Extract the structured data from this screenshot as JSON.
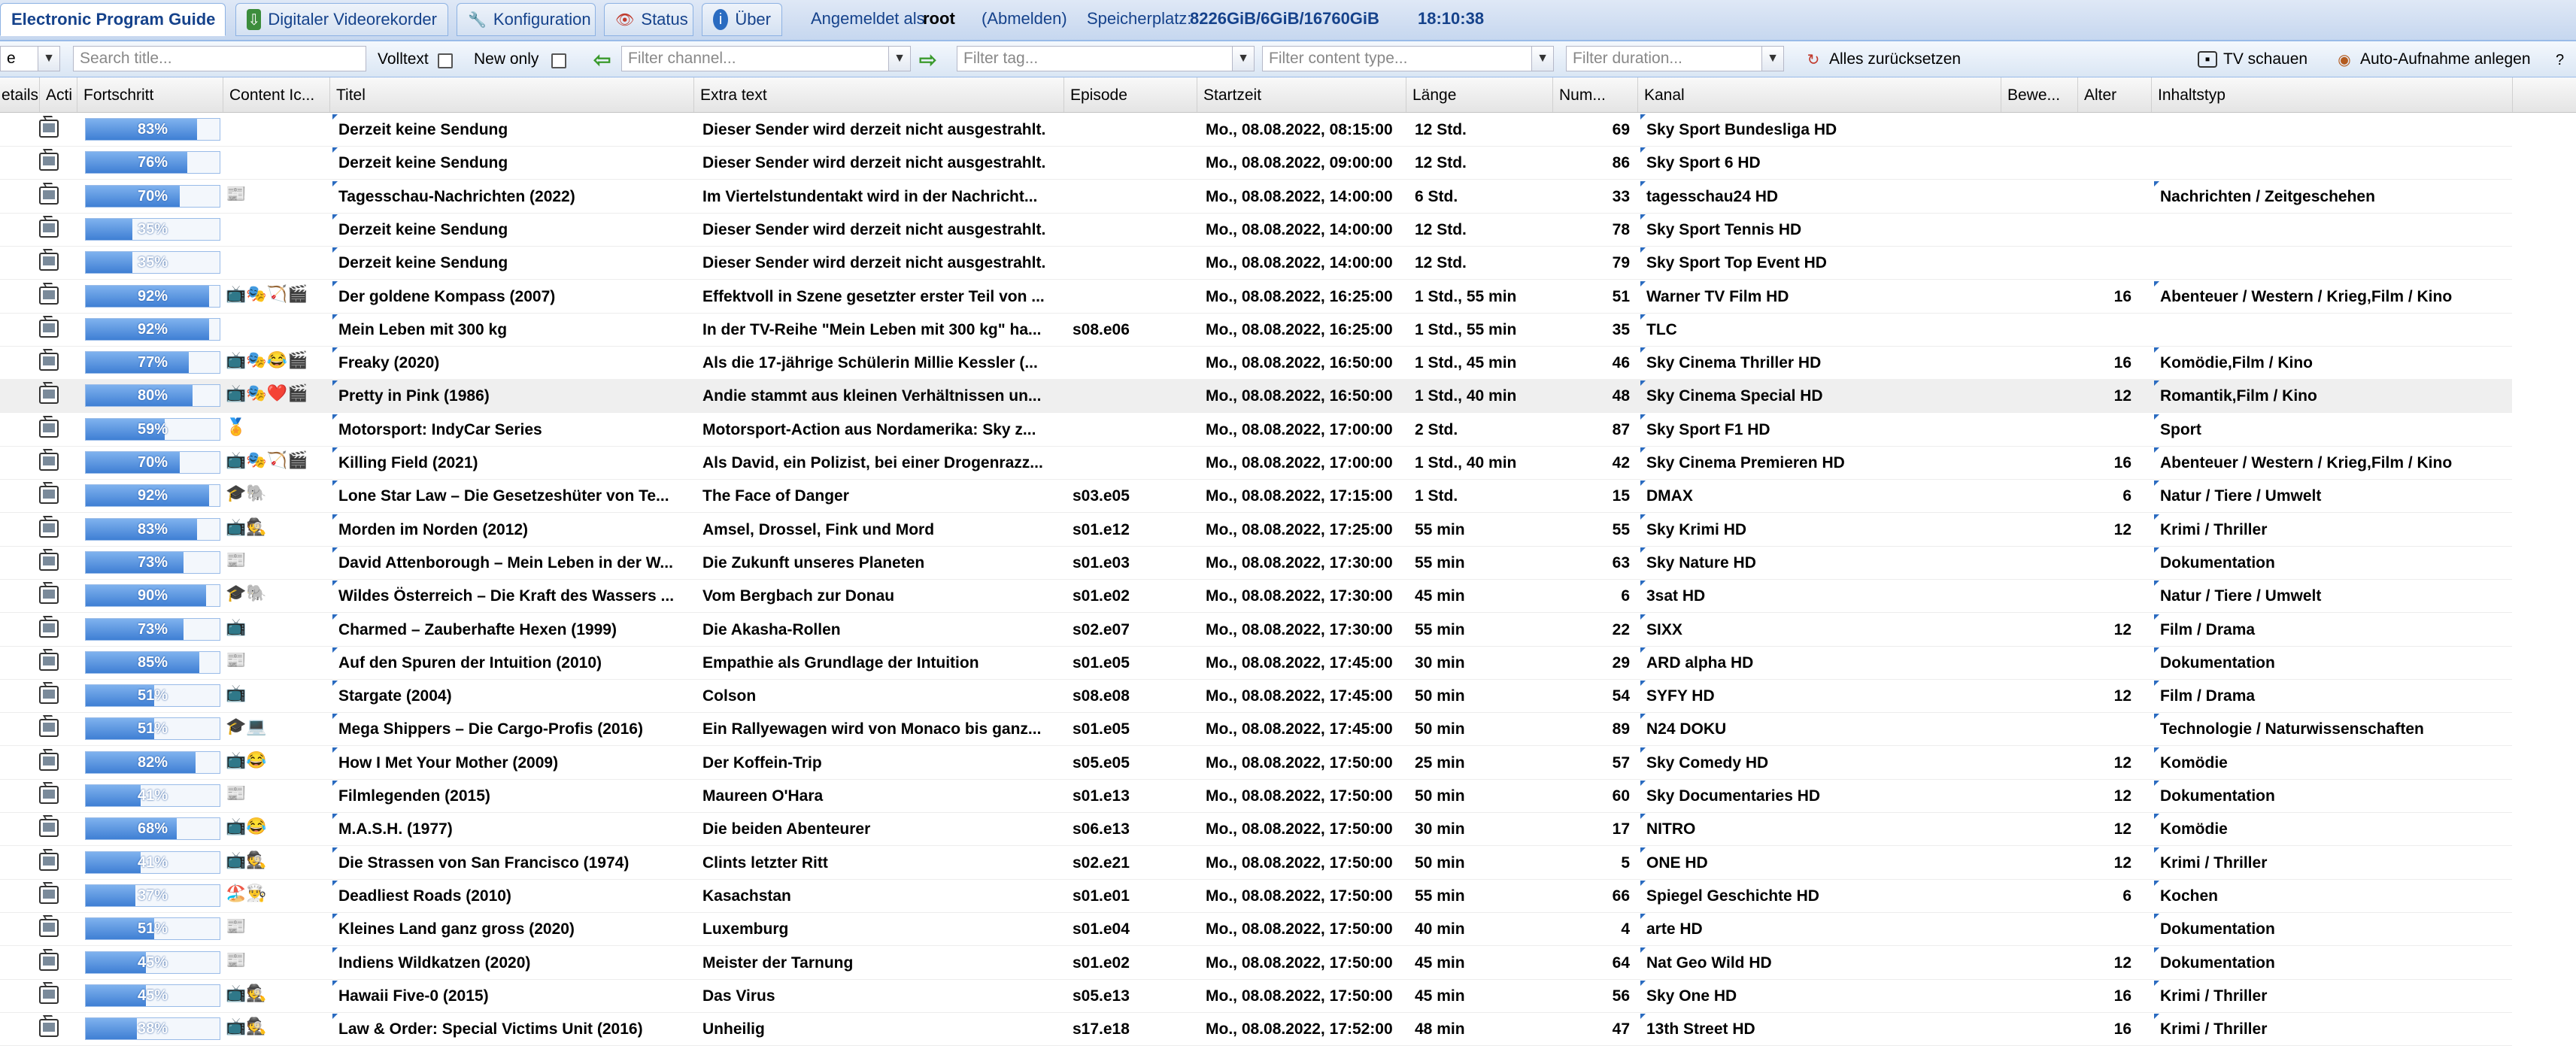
{
  "topbar": {
    "tabs": [
      {
        "label": "Electronic Program Guide",
        "icon": "",
        "active": true
      },
      {
        "label": "Digitaler Videorekorder",
        "icon": "dvr-icon",
        "active": false
      },
      {
        "label": "Konfiguration",
        "icon": "wrench-icon",
        "active": false
      },
      {
        "label": "Status",
        "icon": "eye-icon",
        "active": false
      },
      {
        "label": "Über",
        "icon": "info-icon",
        "active": false
      }
    ],
    "login_prefix": "Angemeldet als",
    "user": "root",
    "logout": "(Abmelden)",
    "storage_label": "Speicherplatz:",
    "storage_value": "8226GiB/6GiB/16760GiB",
    "clock": "18:10:38"
  },
  "toolbar": {
    "first_combo": "e",
    "title_placeholder": "Search title...",
    "volltext_label": "Volltext",
    "new_only_label": "New only",
    "channel_placeholder": "Filter channel...",
    "tag_placeholder": "Filter tag...",
    "content_placeholder": "Filter content type...",
    "duration_placeholder": "Filter duration...",
    "reset_label": "Alles zurücksetzen",
    "tv_label": "TV schauen",
    "auto_rec_label": "Auto-Aufnahme anlegen"
  },
  "columns": [
    "etails",
    "Acti",
    "Fortschritt",
    "Content Ic...",
    "Titel",
    "Extra text",
    "Episode",
    "Startzeit",
    "Länge",
    "Num...",
    "Kanal",
    "Bewe...",
    "Alter",
    "Inhaltstyp"
  ],
  "rows": [
    {
      "progress": 83,
      "p": "83%",
      "emo": "",
      "title": "Derzeit keine Sendung",
      "extra": "Dieser Sender wird derzeit nicht ausgestrahlt.",
      "ep": "",
      "start": "Mo., 08.08.2022, 08:15:00",
      "len": "12 Std.",
      "num": "69",
      "channel": "Sky Sport Bundesliga HD",
      "age": "",
      "type": ""
    },
    {
      "progress": 76,
      "p": "76%",
      "emo": "",
      "title": "Derzeit keine Sendung",
      "extra": "Dieser Sender wird derzeit nicht ausgestrahlt.",
      "ep": "",
      "start": "Mo., 08.08.2022, 09:00:00",
      "len": "12 Std.",
      "num": "86",
      "channel": "Sky Sport 6 HD",
      "age": "",
      "type": ""
    },
    {
      "progress": 70,
      "p": "70%",
      "emo": "📰",
      "title": "Tagesschau-Nachrichten (2022)",
      "extra": "Im Viertelstundentakt wird in der Nachricht...",
      "ep": "",
      "start": "Mo., 08.08.2022, 14:00:00",
      "len": "6 Std.",
      "num": "33",
      "channel": "tagesschau24 HD",
      "age": "",
      "type": "Nachrichten / Zeitgeschehen"
    },
    {
      "progress": 35,
      "p": "35%",
      "emo": "",
      "title": "Derzeit keine Sendung",
      "extra": "Dieser Sender wird derzeit nicht ausgestrahlt.",
      "ep": "",
      "start": "Mo., 08.08.2022, 14:00:00",
      "len": "12 Std.",
      "num": "78",
      "channel": "Sky Sport Tennis HD",
      "age": "",
      "type": ""
    },
    {
      "progress": 35,
      "p": "35%",
      "emo": "",
      "title": "Derzeit keine Sendung",
      "extra": "Dieser Sender wird derzeit nicht ausgestrahlt.",
      "ep": "",
      "start": "Mo., 08.08.2022, 14:00:00",
      "len": "12 Std.",
      "num": "79",
      "channel": "Sky Sport Top Event HD",
      "age": "",
      "type": ""
    },
    {
      "progress": 92,
      "p": "92%",
      "emo": "📺🎭🏹🎬",
      "title": "Der goldene Kompass (2007)",
      "extra": "Effektvoll in Szene gesetzter erster Teil von ...",
      "ep": "",
      "start": "Mo., 08.08.2022, 16:25:00",
      "len": "1 Std., 55 min",
      "num": "51",
      "channel": "Warner TV Film HD",
      "age": "16",
      "type": "Abenteuer / Western / Krieg,Film / Kino"
    },
    {
      "progress": 92,
      "p": "92%",
      "emo": "",
      "title": "Mein Leben mit 300 kg",
      "extra": "In der TV-Reihe \"Mein Leben mit 300 kg\" ha...",
      "ep": "s08.e06",
      "start": "Mo., 08.08.2022, 16:25:00",
      "len": "1 Std., 55 min",
      "num": "35",
      "channel": "TLC",
      "age": "",
      "type": ""
    },
    {
      "progress": 77,
      "p": "77%",
      "emo": "📺🎭😂🎬",
      "title": "Freaky (2020)",
      "extra": "Als die 17-jährige Schülerin Millie Kessler (...",
      "ep": "",
      "start": "Mo., 08.08.2022, 16:50:00",
      "len": "1 Std., 45 min",
      "num": "46",
      "channel": "Sky Cinema Thriller HD",
      "age": "16",
      "type": "Komödie,Film / Kino"
    },
    {
      "progress": 80,
      "p": "80%",
      "emo": "📺🎭❤️🎬",
      "title": "Pretty in Pink (1986)",
      "extra": "Andie stammt aus kleinen Verhältnissen un...",
      "ep": "",
      "start": "Mo., 08.08.2022, 16:50:00",
      "len": "1 Std., 40 min",
      "num": "48",
      "channel": "Sky Cinema Special HD",
      "age": "12",
      "type": "Romantik,Film / Kino",
      "selected": true
    },
    {
      "progress": 59,
      "p": "59%",
      "emo": "🏅",
      "title": "Motorsport: IndyCar Series",
      "extra": "Motorsport-Action aus Nordamerika: Sky z...",
      "ep": "",
      "start": "Mo., 08.08.2022, 17:00:00",
      "len": "2 Std.",
      "num": "87",
      "channel": "Sky Sport F1 HD",
      "age": "",
      "type": "Sport"
    },
    {
      "progress": 70,
      "p": "70%",
      "emo": "📺🎭🏹🎬",
      "title": "Killing Field (2021)",
      "extra": "Als David, ein Polizist, bei einer Drogenrazz...",
      "ep": "",
      "start": "Mo., 08.08.2022, 17:00:00",
      "len": "1 Std., 40 min",
      "num": "42",
      "channel": "Sky Cinema Premieren HD",
      "age": "16",
      "type": "Abenteuer / Western / Krieg,Film / Kino"
    },
    {
      "progress": 92,
      "p": "92%",
      "emo": "🎓🐘",
      "title": "Lone Star Law – Die Gesetzeshüter von Te...",
      "extra": "The Face of Danger",
      "ep": "s03.e05",
      "start": "Mo., 08.08.2022, 17:15:00",
      "len": "1 Std.",
      "num": "15",
      "channel": "DMAX",
      "age": "6",
      "type": "Natur / Tiere / Umwelt"
    },
    {
      "progress": 83,
      "p": "83%",
      "emo": "📺🕵️",
      "title": "Morden im Norden (2012)",
      "extra": "Amsel, Drossel, Fink und Mord",
      "ep": "s01.e12",
      "start": "Mo., 08.08.2022, 17:25:00",
      "len": "55 min",
      "num": "55",
      "channel": "Sky Krimi HD",
      "age": "12",
      "type": "Krimi / Thriller"
    },
    {
      "progress": 73,
      "p": "73%",
      "emo": "📰",
      "title": "David Attenborough – Mein Leben in der W...",
      "extra": "Die Zukunft unseres Planeten",
      "ep": "s01.e03",
      "start": "Mo., 08.08.2022, 17:30:00",
      "len": "55 min",
      "num": "63",
      "channel": "Sky Nature HD",
      "age": "",
      "type": "Dokumentation"
    },
    {
      "progress": 90,
      "p": "90%",
      "emo": "🎓🐘",
      "title": "Wildes Österreich – Die Kraft des Wassers ...",
      "extra": "Vom Bergbach zur Donau",
      "ep": "s01.e02",
      "start": "Mo., 08.08.2022, 17:30:00",
      "len": "45 min",
      "num": "6",
      "channel": "3sat HD",
      "age": "",
      "type": "Natur / Tiere / Umwelt"
    },
    {
      "progress": 73,
      "p": "73%",
      "emo": "📺",
      "title": "Charmed – Zauberhafte Hexen (1999)",
      "extra": "Die Akasha-Rollen",
      "ep": "s02.e07",
      "start": "Mo., 08.08.2022, 17:30:00",
      "len": "55 min",
      "num": "22",
      "channel": "SIXX",
      "age": "12",
      "type": "Film / Drama"
    },
    {
      "progress": 85,
      "p": "85%",
      "emo": "📰",
      "title": "Auf den Spuren der Intuition (2010)",
      "extra": "Empathie als Grundlage der Intuition",
      "ep": "s01.e05",
      "start": "Mo., 08.08.2022, 17:45:00",
      "len": "30 min",
      "num": "29",
      "channel": "ARD alpha HD",
      "age": "",
      "type": "Dokumentation"
    },
    {
      "progress": 51,
      "p": "51%",
      "emo": "📺",
      "title": "Stargate (2004)",
      "extra": "Colson",
      "ep": "s08.e08",
      "start": "Mo., 08.08.2022, 17:45:00",
      "len": "50 min",
      "num": "54",
      "channel": "SYFY HD",
      "age": "12",
      "type": "Film / Drama"
    },
    {
      "progress": 51,
      "p": "51%",
      "emo": "🎓💻",
      "title": "Mega Shippers – Die Cargo-Profis (2016)",
      "extra": "Ein Rallyewagen wird von Monaco bis ganz...",
      "ep": "s01.e05",
      "start": "Mo., 08.08.2022, 17:45:00",
      "len": "50 min",
      "num": "89",
      "channel": "N24 DOKU",
      "age": "",
      "type": "Technologie / Naturwissenschaften"
    },
    {
      "progress": 82,
      "p": "82%",
      "emo": "📺😂",
      "title": "How I Met Your Mother (2009)",
      "extra": "Der Koffein-Trip",
      "ep": "s05.e05",
      "start": "Mo., 08.08.2022, 17:50:00",
      "len": "25 min",
      "num": "57",
      "channel": "Sky Comedy HD",
      "age": "12",
      "type": "Komödie"
    },
    {
      "progress": 41,
      "p": "41%",
      "emo": "📰",
      "title": "Filmlegenden (2015)",
      "extra": "Maureen O'Hara",
      "ep": "s01.e13",
      "start": "Mo., 08.08.2022, 17:50:00",
      "len": "50 min",
      "num": "60",
      "channel": "Sky Documentaries HD",
      "age": "12",
      "type": "Dokumentation"
    },
    {
      "progress": 68,
      "p": "68%",
      "emo": "📺😂",
      "title": "M.A.S.H. (1977)",
      "extra": "Die beiden Abenteurer",
      "ep": "s06.e13",
      "start": "Mo., 08.08.2022, 17:50:00",
      "len": "30 min",
      "num": "17",
      "channel": "NITRO",
      "age": "12",
      "type": "Komödie"
    },
    {
      "progress": 41,
      "p": "41%",
      "emo": "📺🕵️",
      "title": "Die Strassen von San Francisco (1974)",
      "extra": "Clints letzter Ritt",
      "ep": "s02.e21",
      "start": "Mo., 08.08.2022, 17:50:00",
      "len": "50 min",
      "num": "5",
      "channel": "ONE HD",
      "age": "12",
      "type": "Krimi / Thriller"
    },
    {
      "progress": 37,
      "p": "37%",
      "emo": "🏖️👨‍🍳",
      "title": "Deadliest Roads (2010)",
      "extra": "Kasachstan",
      "ep": "s01.e01",
      "start": "Mo., 08.08.2022, 17:50:00",
      "len": "55 min",
      "num": "66",
      "channel": "Spiegel Geschichte HD",
      "age": "6",
      "type": "Kochen"
    },
    {
      "progress": 51,
      "p": "51%",
      "emo": "📰",
      "title": "Kleines Land ganz gross (2020)",
      "extra": "Luxemburg",
      "ep": "s01.e04",
      "start": "Mo., 08.08.2022, 17:50:00",
      "len": "40 min",
      "num": "4",
      "channel": "arte HD",
      "age": "",
      "type": "Dokumentation"
    },
    {
      "progress": 45,
      "p": "45%",
      "emo": "📰",
      "title": "Indiens Wildkatzen (2020)",
      "extra": "Meister der Tarnung",
      "ep": "s01.e02",
      "start": "Mo., 08.08.2022, 17:50:00",
      "len": "45 min",
      "num": "64",
      "channel": "Nat Geo Wild HD",
      "age": "12",
      "type": "Dokumentation"
    },
    {
      "progress": 45,
      "p": "45%",
      "emo": "📺🕵️",
      "title": "Hawaii Five-0 (2015)",
      "extra": "Das Virus",
      "ep": "s05.e13",
      "start": "Mo., 08.08.2022, 17:50:00",
      "len": "45 min",
      "num": "56",
      "channel": "Sky One HD",
      "age": "16",
      "type": "Krimi / Thriller"
    },
    {
      "progress": 38,
      "p": "38%",
      "emo": "📺🕵️",
      "title": "Law & Order: Special Victims Unit (2016)",
      "extra": "Unheilig",
      "ep": "s17.e18",
      "start": "Mo., 08.08.2022, 17:52:00",
      "len": "48 min",
      "num": "47",
      "channel": "13th Street HD",
      "age": "16",
      "type": "Krimi / Thriller"
    }
  ]
}
